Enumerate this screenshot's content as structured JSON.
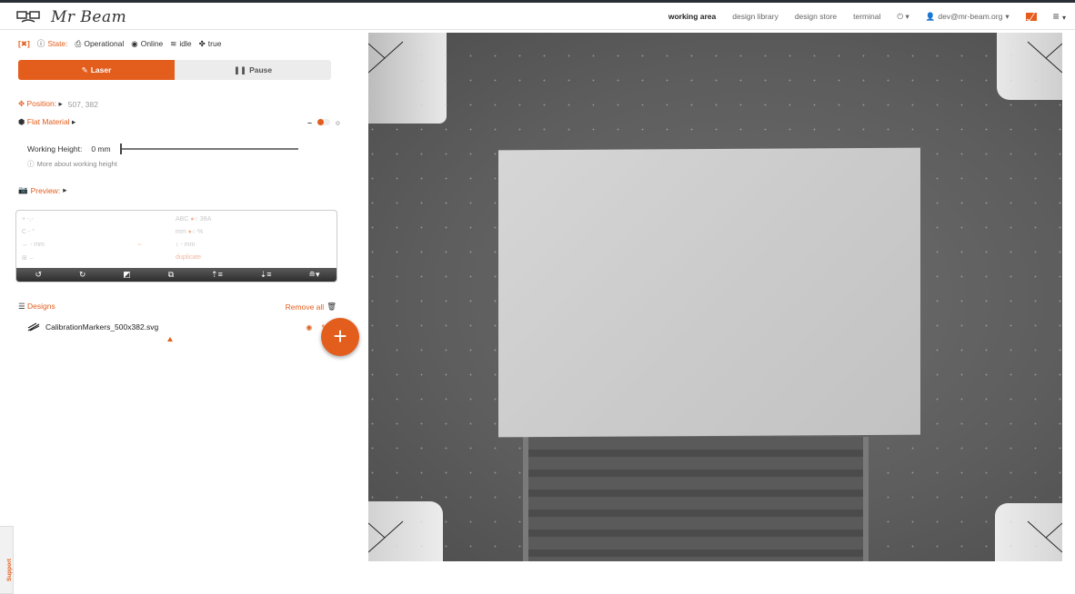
{
  "brand": {
    "logo_text": "Mr Beam"
  },
  "nav": {
    "items": [
      "working area",
      "design library",
      "design store",
      "terminal"
    ],
    "user": "dev@mr-beam.org"
  },
  "state": {
    "bracket": "[✖]",
    "label": "State:",
    "status": "Operational",
    "connection": "Online",
    "activity": "idle",
    "flag": "true"
  },
  "buttons": {
    "laser": "Laser",
    "pause": "Pause"
  },
  "position": {
    "label": "Position:",
    "value": "507, 382"
  },
  "flat_material": {
    "label": "Flat Material"
  },
  "working_height": {
    "label": "Working Height:",
    "value": "0 mm",
    "more": "More about working height"
  },
  "preview": {
    "label": "Preview:"
  },
  "toolbox": {
    "line1_left": "+ -,-",
    "line1_right": "ABC",
    "line1_right2": "38A",
    "line2_left": "C - °",
    "line2_right": "mm",
    "line2_right2": "%",
    "line3_left": "↔ - mm",
    "line3_mid": "⇔",
    "line3_right": "↕ - mm",
    "line4_left": "⊞ ←",
    "line4_right": "duplicate"
  },
  "designs": {
    "label": "Designs",
    "remove_all": "Remove all",
    "items": [
      {
        "name": "CalibrationMarkers_500x382.svg"
      }
    ]
  },
  "support": {
    "label": "Support"
  },
  "colors": {
    "accent": "#e35d1d",
    "dark": "#2a2f36"
  }
}
